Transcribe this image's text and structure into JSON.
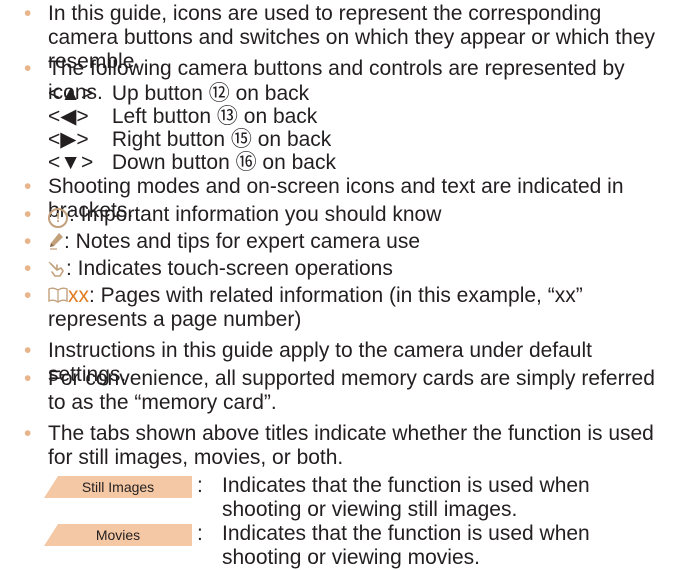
{
  "bullet_char": "•",
  "colors": {
    "bullet": "#e8b48a",
    "tab_fill": "#f4c8a4",
    "icon": "#c2a07c",
    "page_ref": "#e07b20"
  },
  "items": {
    "b1": "In this guide, icons are used to represent the corresponding camera buttons and switches on which they appear or which they resemble.",
    "b2": "The following camera buttons and controls are represented by icons.",
    "buttons": [
      {
        "key": "<▲>",
        "desc": "Up button ⑫ on back"
      },
      {
        "key": "<◀>",
        "desc": "Left button ⑬ on back"
      },
      {
        "key": "<▶>",
        "desc": "Right button ⑮ on back"
      },
      {
        "key": "<▼>",
        "desc": "Down button ⑯ on back"
      }
    ],
    "b3": "Shooting modes and on-screen icons and text are indicated in brackets.",
    "b4_icon": "!",
    "b4_icon_name": "important-icon",
    "b4": ": Important information you should know",
    "b5_icon_name": "pencil-note-icon",
    "b5": ": Notes and tips for expert camera use",
    "b6_icon_name": "touch-icon",
    "b6": ": Indicates touch-screen operations",
    "b7_icon_name": "book-icon",
    "b7_ref": "xx",
    "b7": ": Pages with related information (in this example, “xx” represents a page number)",
    "b8": "Instructions in this guide apply to the camera under default settings.",
    "b9": "For convenience, all supported memory cards are simply referred to as the “memory card”.",
    "b10": "The tabs shown above titles indicate whether the function is used for still images, movies, or both.",
    "tabs": [
      {
        "label": "Still Images",
        "desc": "Indicates that the function is used when shooting or viewing still images."
      },
      {
        "label": "Movies",
        "desc": "Indicates that the function is used when shooting or viewing movies."
      }
    ],
    "colon": ":"
  }
}
